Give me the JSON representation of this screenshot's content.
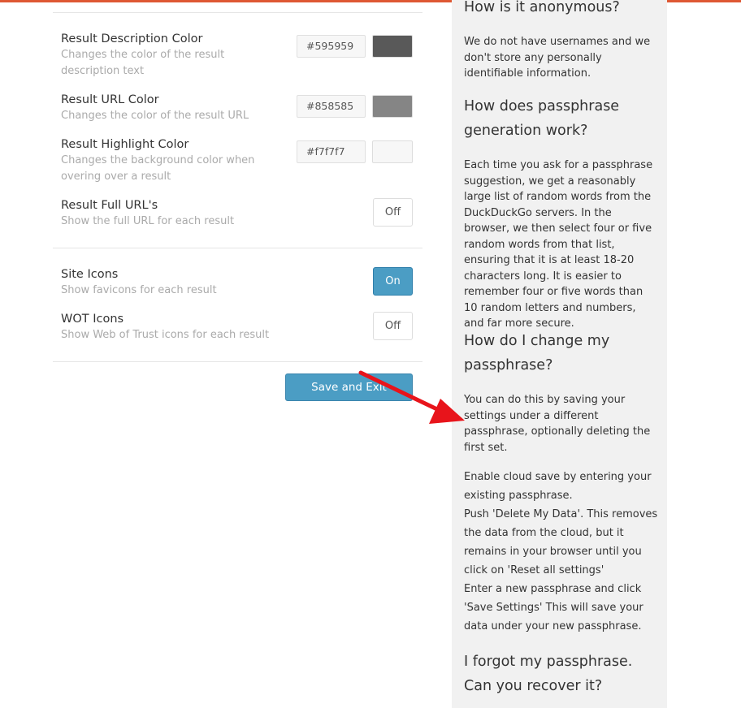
{
  "settings": {
    "rows": [
      {
        "title": "Result Description Color",
        "desc": "Changes the color of the result description text",
        "value": "#595959",
        "swatch": "#595959"
      },
      {
        "title": "Result URL Color",
        "desc": "Changes the color of the result URL",
        "value": "#858585",
        "swatch": "#858585"
      },
      {
        "title": "Result Highlight Color",
        "desc": "Changes the background color when overing over a result",
        "value": "#f7f7f7",
        "swatch": "#f7f7f7"
      },
      {
        "title": "Result Full URL's",
        "desc": "Show the full URL for each result",
        "toggle": "Off"
      },
      {
        "title": "Site Icons",
        "desc": "Show favicons for each result",
        "toggle": "On"
      },
      {
        "title": "WOT Icons",
        "desc": "Show Web of Trust icons for each result",
        "toggle": "Off"
      }
    ],
    "save_label": "Save and Exit"
  },
  "faq": {
    "q1": "How is it anonymous?",
    "a1": "We do not have usernames and we don't store any personally identifiable information.",
    "q2": "How does passphrase generation work?",
    "a2": "Each time you ask for a passphrase suggestion, we get a reasonably large list of random words from the DuckDuckGo servers. In the browser, we then select four or five random words from that list, ensuring that it is at least 18-20 characters long. It is easier to remember four or five words than 10 random letters and numbers, and far more secure.",
    "q3": "How do I change my passphrase?",
    "a3": "You can do this by saving your settings under a different passphrase, optionally deleting the first set.",
    "a3_steps": [
      "Enable cloud save by entering your existing passphrase.",
      "Push 'Delete My Data'. This removes the data from the cloud, but it remains in your browser until you click on 'Reset all settings'",
      "Enter a new passphrase and click 'Save Settings' This will save your data under your new passphrase."
    ],
    "q4": "I forgot my passphrase. Can you recover it?"
  },
  "colors": {
    "accent": "#4b9dc4",
    "brand_bar": "#de5833",
    "annotation_arrow": "#e8141b",
    "faq_bg": "#f1f1f1"
  }
}
